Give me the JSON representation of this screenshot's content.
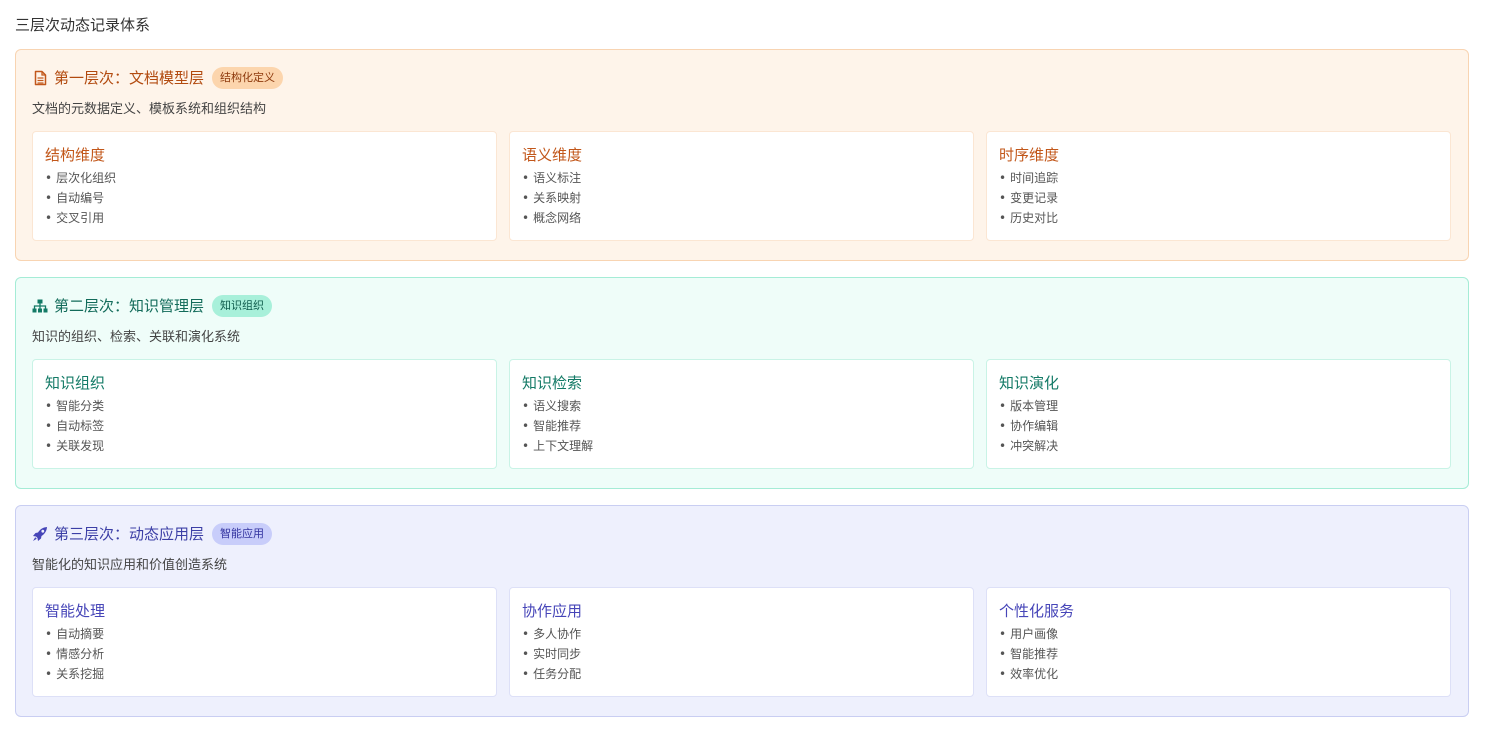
{
  "page": {
    "title": "三层次动态记录体系"
  },
  "colors": {
    "layer1_accent": "#c2571a",
    "layer2_accent": "#137a66",
    "layer3_accent": "#4645b8"
  },
  "layers": [
    {
      "icon": "document-icon",
      "title": "第一层次：文档模型层",
      "badge": "结构化定义",
      "description": "文档的元数据定义、模板系统和组织结构",
      "cards": [
        {
          "title": "结构维度",
          "items": [
            "层次化组织",
            "自动编号",
            "交叉引用"
          ]
        },
        {
          "title": "语义维度",
          "items": [
            "语义标注",
            "关系映射",
            "概念网络"
          ]
        },
        {
          "title": "时序维度",
          "items": [
            "时间追踪",
            "变更记录",
            "历史对比"
          ]
        }
      ]
    },
    {
      "icon": "sitemap-icon",
      "title": "第二层次：知识管理层",
      "badge": "知识组织",
      "description": "知识的组织、检索、关联和演化系统",
      "cards": [
        {
          "title": "知识组织",
          "items": [
            "智能分类",
            "自动标签",
            "关联发现"
          ]
        },
        {
          "title": "知识检索",
          "items": [
            "语义搜索",
            "智能推荐",
            "上下文理解"
          ]
        },
        {
          "title": "知识演化",
          "items": [
            "版本管理",
            "协作编辑",
            "冲突解决"
          ]
        }
      ]
    },
    {
      "icon": "rocket-icon",
      "title": "第三层次：动态应用层",
      "badge": "智能应用",
      "description": "智能化的知识应用和价值创造系统",
      "cards": [
        {
          "title": "智能处理",
          "items": [
            "自动摘要",
            "情感分析",
            "关系挖掘"
          ]
        },
        {
          "title": "协作应用",
          "items": [
            "多人协作",
            "实时同步",
            "任务分配"
          ]
        },
        {
          "title": "个性化服务",
          "items": [
            "用户画像",
            "智能推荐",
            "效率优化"
          ]
        }
      ]
    }
  ],
  "bullet": "•"
}
